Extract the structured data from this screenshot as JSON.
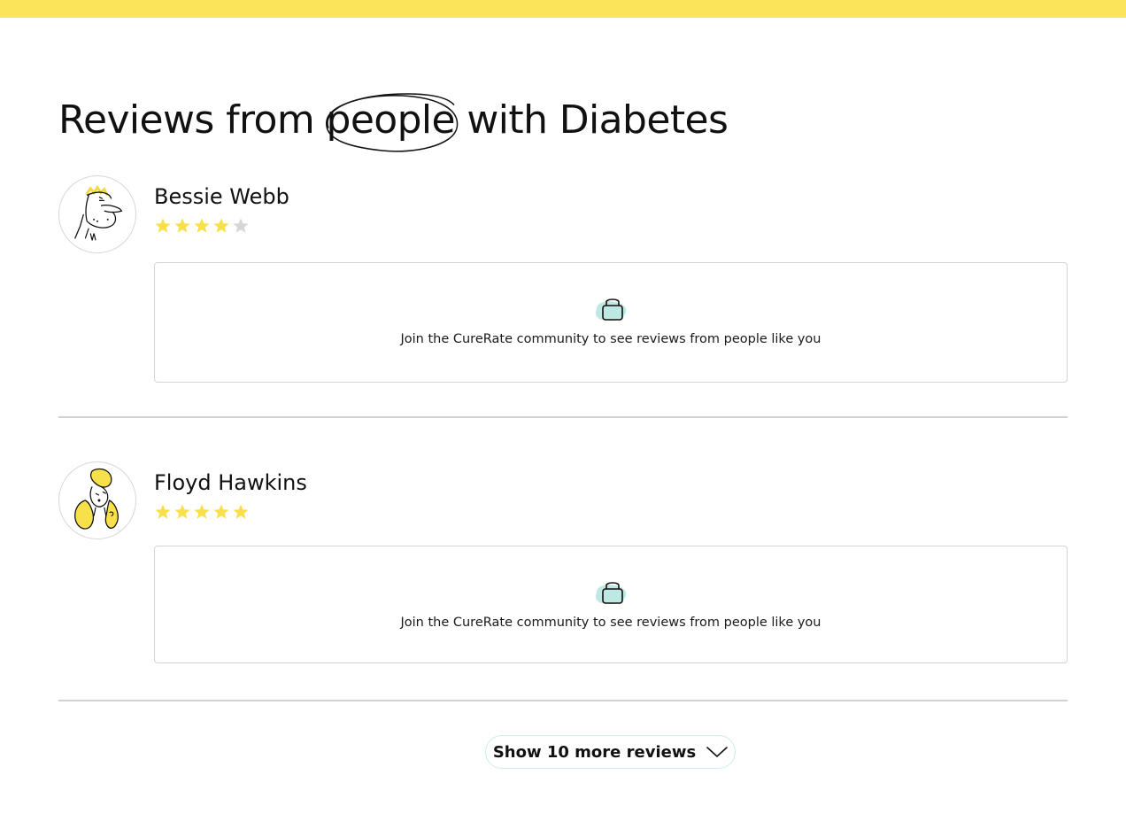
{
  "heading": {
    "before": "Reviews from ",
    "highlight": "people",
    "after": " with Diabetes"
  },
  "reviews": [
    {
      "name": "Bessie Webb",
      "rating": 4,
      "max_rating": 5,
      "locked_text": "Join the CureRate community to see reviews from people like you",
      "avatar": "bald-man-avatar"
    },
    {
      "name": "Floyd Hawkins",
      "rating": 5,
      "max_rating": 5,
      "locked_text": "Join the CureRate community to see reviews from people like you",
      "avatar": "blonde-woman-avatar"
    }
  ],
  "show_more": {
    "label": "Show 10 more reviews",
    "icon": "chevron-down-icon"
  },
  "colors": {
    "accent_yellow": "#f9e45a",
    "star_filled": "#f7e04a",
    "star_empty": "#d6d6d6",
    "lock_blob": "#bde8e3",
    "button_border": "#cdeee9"
  }
}
